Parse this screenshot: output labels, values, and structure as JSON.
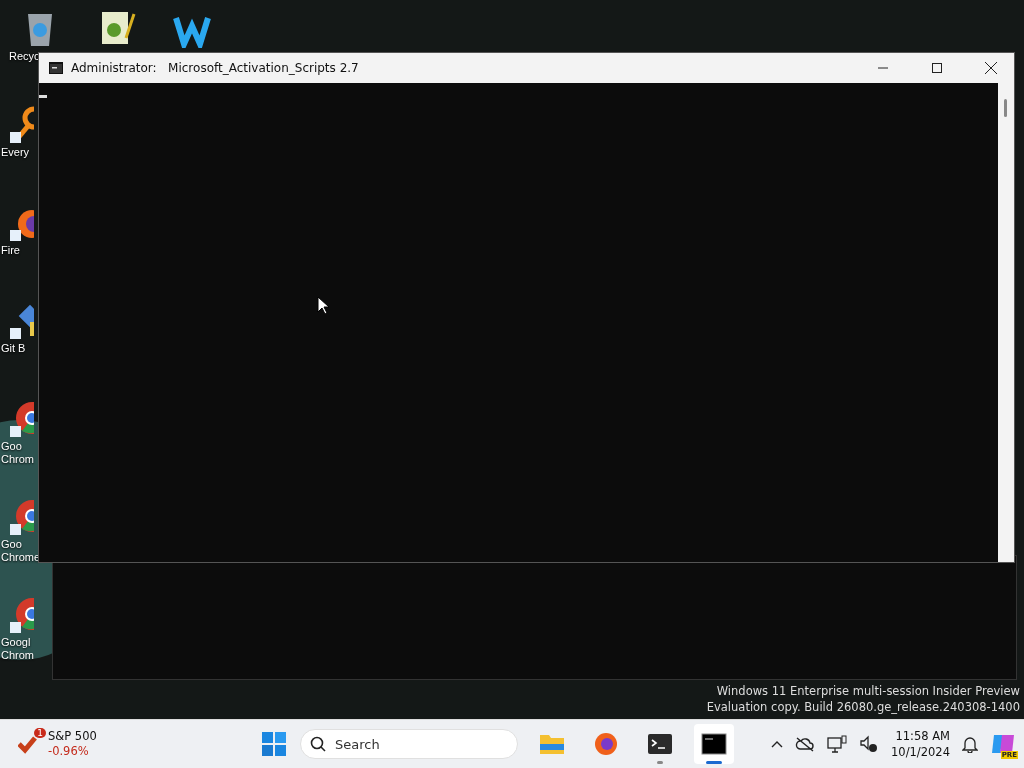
{
  "desktop": {
    "top_icons": [
      {
        "kind": "recycle",
        "label": "Recyc"
      },
      {
        "kind": "notepad"
      },
      {
        "kind": "wapp"
      }
    ],
    "side_icons": [
      {
        "kind": "everything",
        "lines": [
          "Every"
        ]
      },
      {
        "kind": "firefox",
        "lines": [
          "Fire"
        ]
      },
      {
        "kind": "git",
        "lines": [
          "Git B"
        ]
      },
      {
        "kind": "chrome",
        "lines": [
          "Goo",
          "Chrom"
        ]
      },
      {
        "kind": "chrome",
        "lines": [
          "Goo",
          "Chrome"
        ]
      },
      {
        "kind": "chrome",
        "lines": [
          "Googl",
          "Chrom"
        ]
      }
    ],
    "watermark": [
      "Windows 11 Enterprise multi-session Insider Preview",
      "Evaluation copy. Build 26080.ge_release.240308-1400"
    ]
  },
  "window": {
    "title_prefix": "Administrator:",
    "title": "Microsoft_Activation_Scripts 2.7"
  },
  "taskbar": {
    "widget": {
      "badge": "1",
      "name": "S&P 500",
      "change": "-0.96%"
    },
    "search": {
      "placeholder": "Search"
    },
    "apps": [
      {
        "kind": "folder",
        "running": false,
        "selected": false
      },
      {
        "kind": "firefox",
        "running": false,
        "selected": false
      },
      {
        "kind": "terminal",
        "running": true,
        "selected": false
      },
      {
        "kind": "console",
        "running": true,
        "selected": true
      }
    ],
    "time": "11:58 AM",
    "date": "10/1/2024",
    "copilot_badge": "PRE"
  }
}
